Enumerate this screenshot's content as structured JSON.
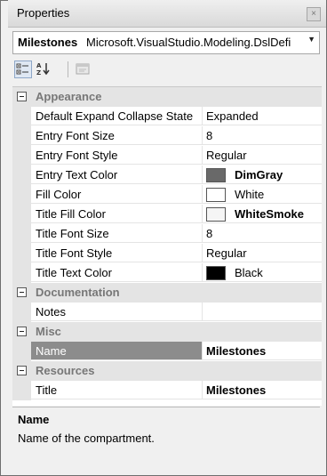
{
  "window": {
    "title": "Properties",
    "close_glyph": "×"
  },
  "object_selector": {
    "name": "Milestones",
    "type": "Microsoft.VisualStudio.Modeling.DslDefi",
    "arrow": "▼"
  },
  "toolbar": {
    "buttons": [
      "categorized-view-icon",
      "alphabetical-sort-icon",
      "property-pages-icon"
    ]
  },
  "grid": {
    "categories": [
      {
        "label": "Appearance",
        "toggle": "collapse-minus",
        "properties": [
          {
            "name": "Default Expand Collapse State",
            "value": "Expanded"
          },
          {
            "name": "Entry Font Size",
            "value": "8"
          },
          {
            "name": "Entry Font Style",
            "value": "Regular"
          },
          {
            "name": "Entry Text Color",
            "value": "DimGray",
            "swatch": "#696969",
            "bold": true
          },
          {
            "name": "Fill Color",
            "value": "White",
            "swatch": "#ffffff"
          },
          {
            "name": "Title Fill Color",
            "value": "WhiteSmoke",
            "swatch": "#f5f5f5",
            "bold": true
          },
          {
            "name": "Title Font Size",
            "value": "8"
          },
          {
            "name": "Title Font Style",
            "value": "Regular"
          },
          {
            "name": "Title Text Color",
            "value": "Black",
            "swatch": "#000000"
          }
        ]
      },
      {
        "label": "Documentation",
        "toggle": "collapse-minus",
        "properties": [
          {
            "name": "Notes",
            "value": ""
          }
        ]
      },
      {
        "label": "Misc",
        "toggle": "collapse-minus",
        "properties": [
          {
            "name": "Name",
            "value": "Milestones",
            "bold": true,
            "selected": true
          }
        ]
      },
      {
        "label": "Resources",
        "toggle": "collapse-minus",
        "properties": [
          {
            "name": "Title",
            "value": "Milestones",
            "bold": true
          }
        ]
      }
    ]
  },
  "description": {
    "title": "Name",
    "text": "Name of the compartment."
  }
}
